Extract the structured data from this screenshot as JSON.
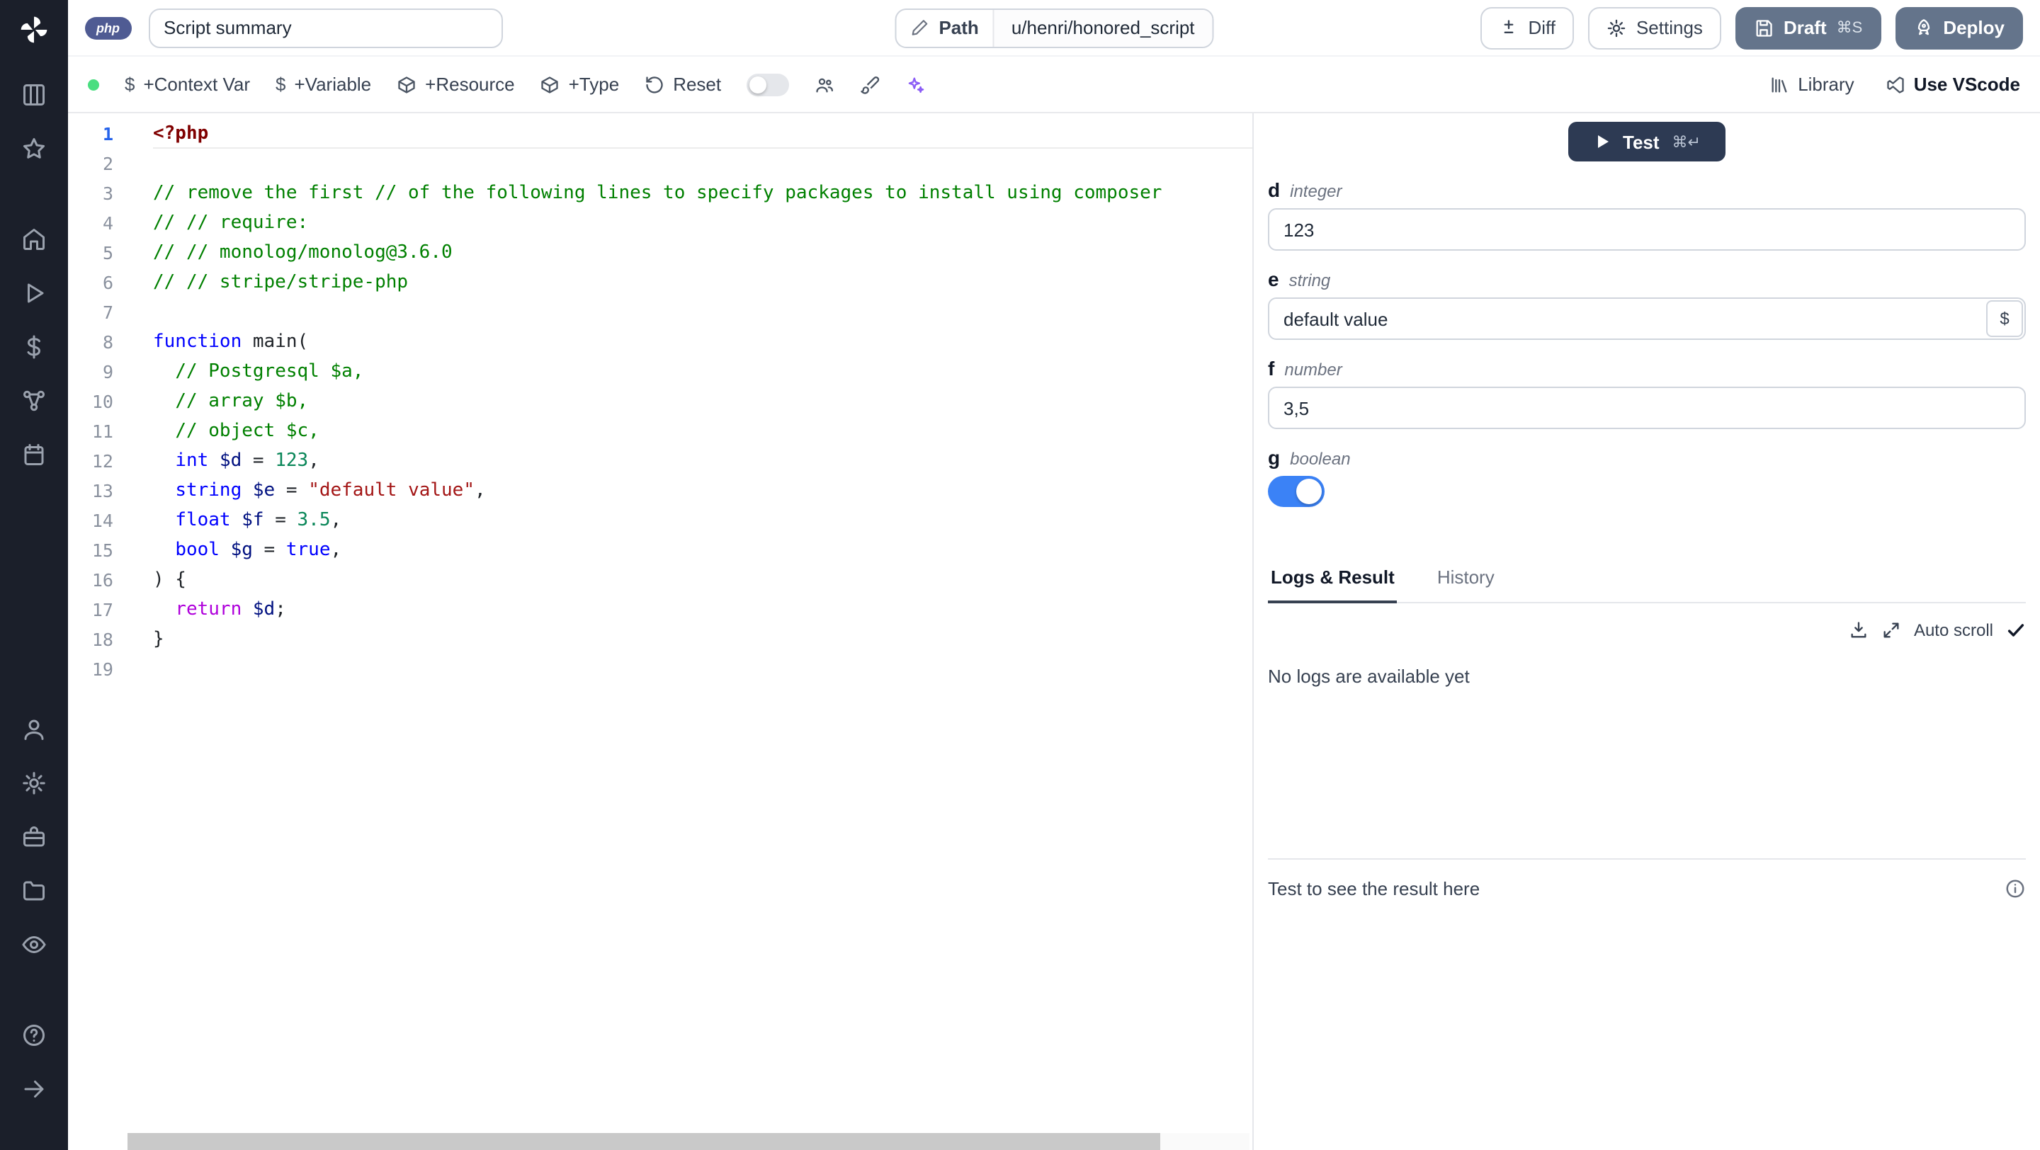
{
  "colors": {
    "sidebar_bg": "#1b1f2a",
    "button_slate": "#64748b",
    "test_button": "#2d3a53",
    "toggle_on_blue": "#3b82f6",
    "status_green": "#4ade80",
    "active_line_number": "#2563eb"
  },
  "sidebar": {
    "icons": [
      "windmill-logo",
      "kanban-icon",
      "star-icon",
      "home-icon",
      "play-icon",
      "dollar-icon",
      "hub-icon",
      "calendar-icon",
      "user-icon",
      "settings-icon",
      "toolbox-icon",
      "folder-icon",
      "eye-icon",
      "help-icon",
      "collapse-right-icon"
    ]
  },
  "topbar": {
    "lang_badge": "php",
    "summary_value": "Script summary",
    "path_label": "Path",
    "path_value": "u/henri/honored_script",
    "diff_label": "Diff",
    "settings_label": "Settings",
    "draft_label": "Draft",
    "draft_shortcut": "⌘S",
    "deploy_label": "Deploy"
  },
  "toolbar": {
    "context_var": "+Context Var",
    "variable": "+Variable",
    "resource": "+Resource",
    "type": "+Type",
    "reset": "Reset",
    "library": "Library",
    "use_vscode": "Use VScode"
  },
  "editor": {
    "language": "php",
    "lines": [
      {
        "n": "1",
        "t": [
          [
            "tag",
            "<?php"
          ]
        ]
      },
      {
        "n": "2",
        "t": []
      },
      {
        "n": "3",
        "t": [
          [
            "com",
            "// remove the first // of the following lines to specify packages to install using composer"
          ]
        ]
      },
      {
        "n": "4",
        "t": [
          [
            "com",
            "// // require:"
          ]
        ]
      },
      {
        "n": "5",
        "t": [
          [
            "com",
            "// // monolog/monolog@3.6.0"
          ]
        ]
      },
      {
        "n": "6",
        "t": [
          [
            "com",
            "// // stripe/stripe-php"
          ]
        ]
      },
      {
        "n": "7",
        "t": []
      },
      {
        "n": "8",
        "t": [
          [
            "kw",
            "function"
          ],
          [
            "pl",
            " "
          ],
          [
            "fn",
            "main"
          ],
          [
            "pl",
            "("
          ]
        ]
      },
      {
        "n": "9",
        "t": [
          [
            "pl",
            "  "
          ],
          [
            "com",
            "// Postgresql $a,"
          ]
        ]
      },
      {
        "n": "10",
        "t": [
          [
            "pl",
            "  "
          ],
          [
            "com",
            "// array $b,"
          ]
        ]
      },
      {
        "n": "11",
        "t": [
          [
            "pl",
            "  "
          ],
          [
            "com",
            "// object $c,"
          ]
        ]
      },
      {
        "n": "12",
        "t": [
          [
            "pl",
            "  "
          ],
          [
            "kw",
            "int"
          ],
          [
            "pl",
            " "
          ],
          [
            "var",
            "$d"
          ],
          [
            "pl",
            " = "
          ],
          [
            "num",
            "123"
          ],
          [
            "pl",
            ","
          ]
        ]
      },
      {
        "n": "13",
        "t": [
          [
            "pl",
            "  "
          ],
          [
            "kw",
            "string"
          ],
          [
            "pl",
            " "
          ],
          [
            "var",
            "$e"
          ],
          [
            "pl",
            " = "
          ],
          [
            "str",
            "\"default value\""
          ],
          [
            "pl",
            ","
          ]
        ]
      },
      {
        "n": "14",
        "t": [
          [
            "pl",
            "  "
          ],
          [
            "kw",
            "float"
          ],
          [
            "pl",
            " "
          ],
          [
            "var",
            "$f"
          ],
          [
            "pl",
            " = "
          ],
          [
            "num",
            "3.5"
          ],
          [
            "pl",
            ","
          ]
        ]
      },
      {
        "n": "15",
        "t": [
          [
            "pl",
            "  "
          ],
          [
            "kw",
            "bool"
          ],
          [
            "pl",
            " "
          ],
          [
            "var",
            "$g"
          ],
          [
            "pl",
            " = "
          ],
          [
            "kw",
            "true"
          ],
          [
            "pl",
            ","
          ]
        ]
      },
      {
        "n": "16",
        "t": [
          [
            "pl",
            ") {"
          ]
        ]
      },
      {
        "n": "17",
        "t": [
          [
            "pl",
            "  "
          ],
          [
            "ctrl",
            "return"
          ],
          [
            "pl",
            " "
          ],
          [
            "var",
            "$d"
          ],
          [
            "pl",
            ";"
          ]
        ]
      },
      {
        "n": "18",
        "t": [
          [
            "pl",
            "}"
          ]
        ]
      },
      {
        "n": "19",
        "t": []
      }
    ]
  },
  "panel": {
    "test_label": "Test",
    "test_shortcut": "⌘↵",
    "dollar_button": "$",
    "fields": [
      {
        "name": "d",
        "type": "integer",
        "value": "123"
      },
      {
        "name": "e",
        "type": "string",
        "value": "default value"
      },
      {
        "name": "f",
        "type": "number",
        "value": "3,5"
      },
      {
        "name": "g",
        "type": "boolean",
        "value": "on"
      }
    ],
    "tabs": [
      "Logs & Result",
      "History"
    ],
    "active_tab": "Logs & Result",
    "auto_scroll_label": "Auto scroll",
    "no_logs_text": "No logs are available yet",
    "result_placeholder": "Test to see the result here"
  }
}
